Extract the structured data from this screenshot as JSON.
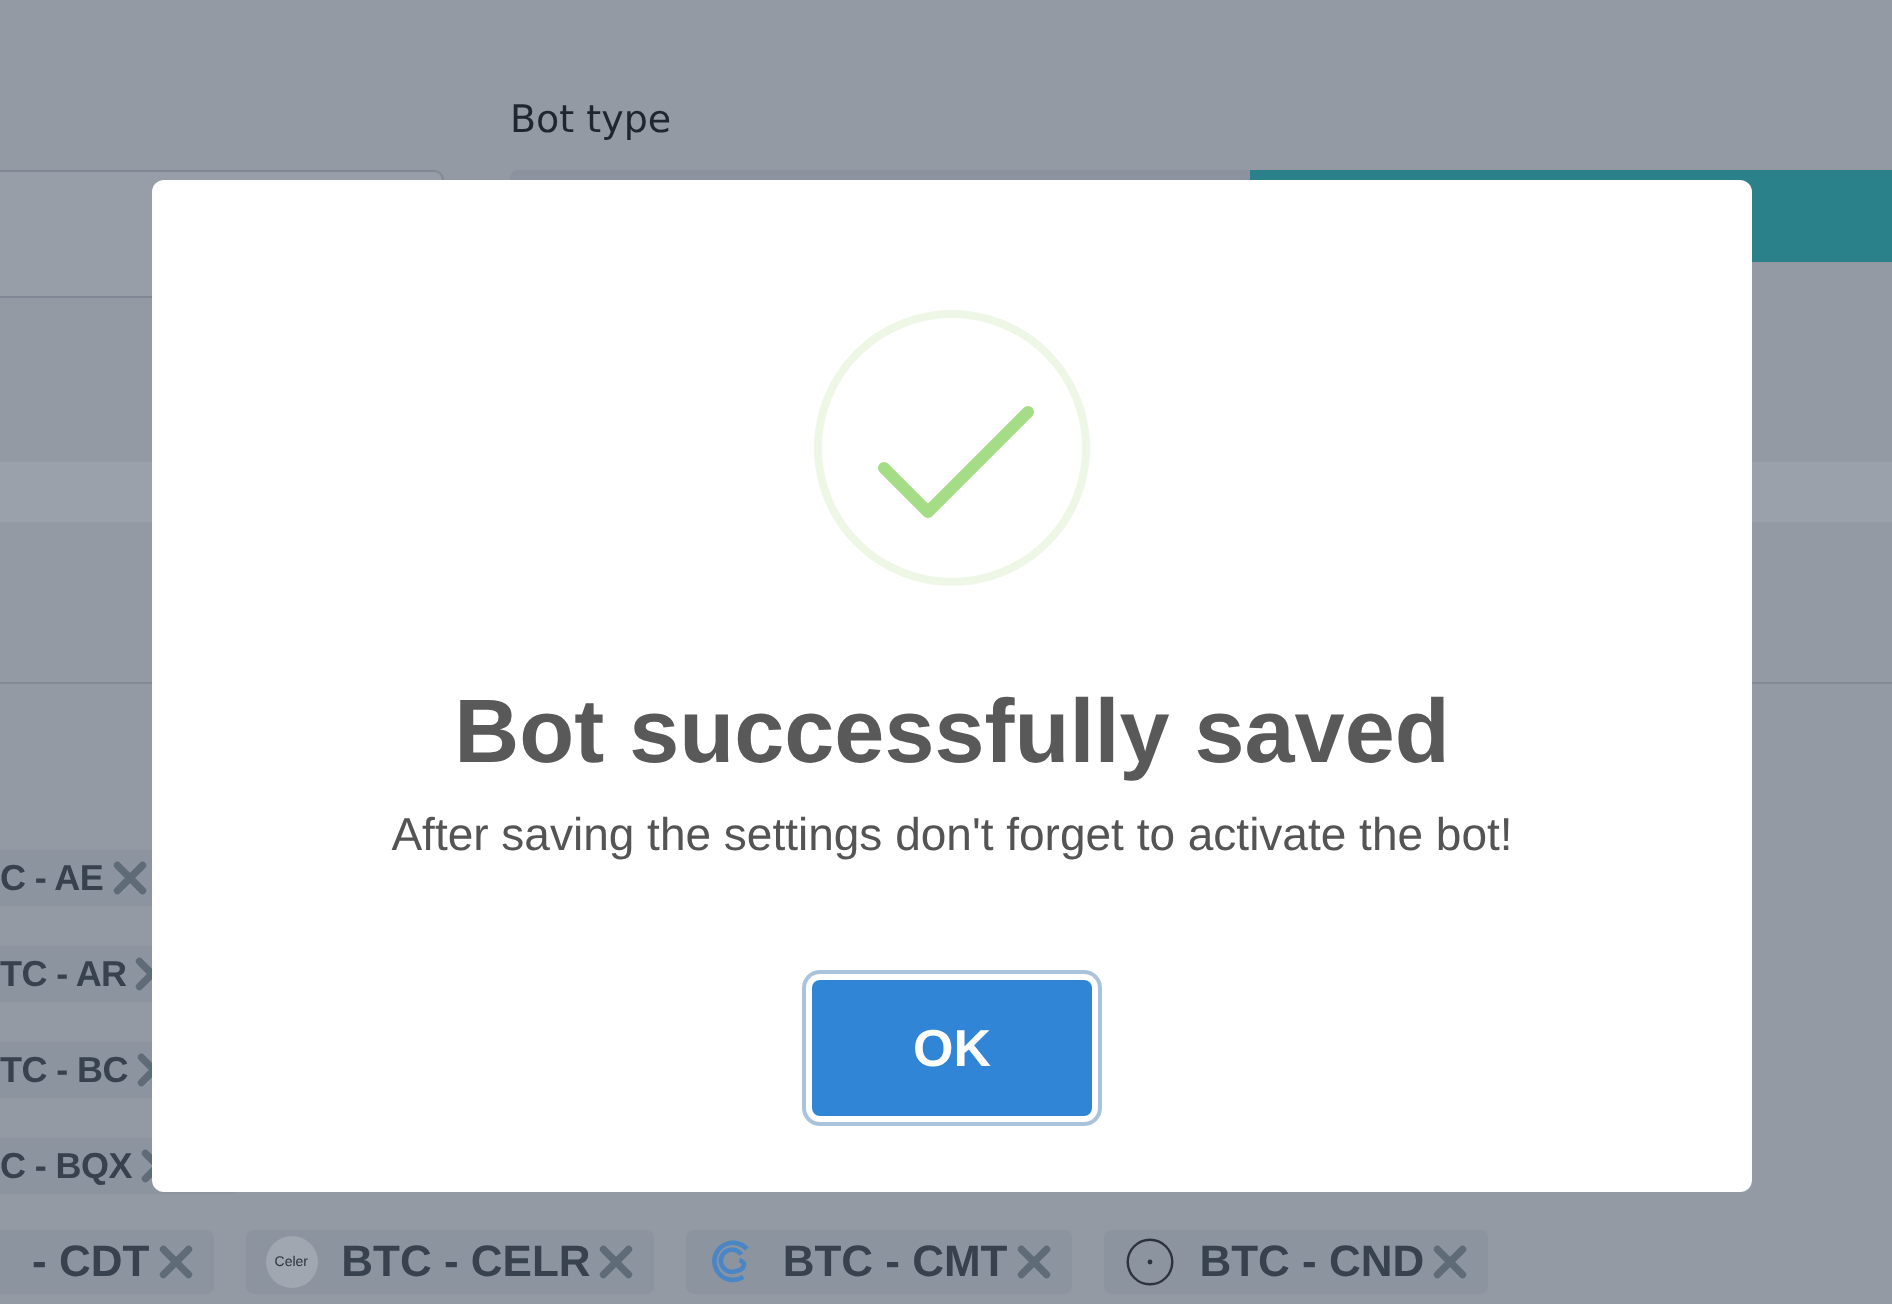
{
  "background": {
    "field_label": "Bot type",
    "left_tags": [
      {
        "label": "C - AE"
      },
      {
        "label": "TC - AR"
      },
      {
        "label": "TC - BC"
      },
      {
        "label": "C - BQX"
      }
    ],
    "bottom_tags": [
      {
        "label": "- CDT",
        "kind": "plain"
      },
      {
        "label": "BTC - CELR",
        "kind": "badge",
        "logo_text": "Celer"
      },
      {
        "label": "BTC - CMT",
        "kind": "swirl"
      },
      {
        "label": "BTC - CND",
        "kind": "dot"
      }
    ]
  },
  "dialog": {
    "title": "Bot successfully saved",
    "message": "After saving the settings don't forget to activate the bot!",
    "button": "OK"
  }
}
